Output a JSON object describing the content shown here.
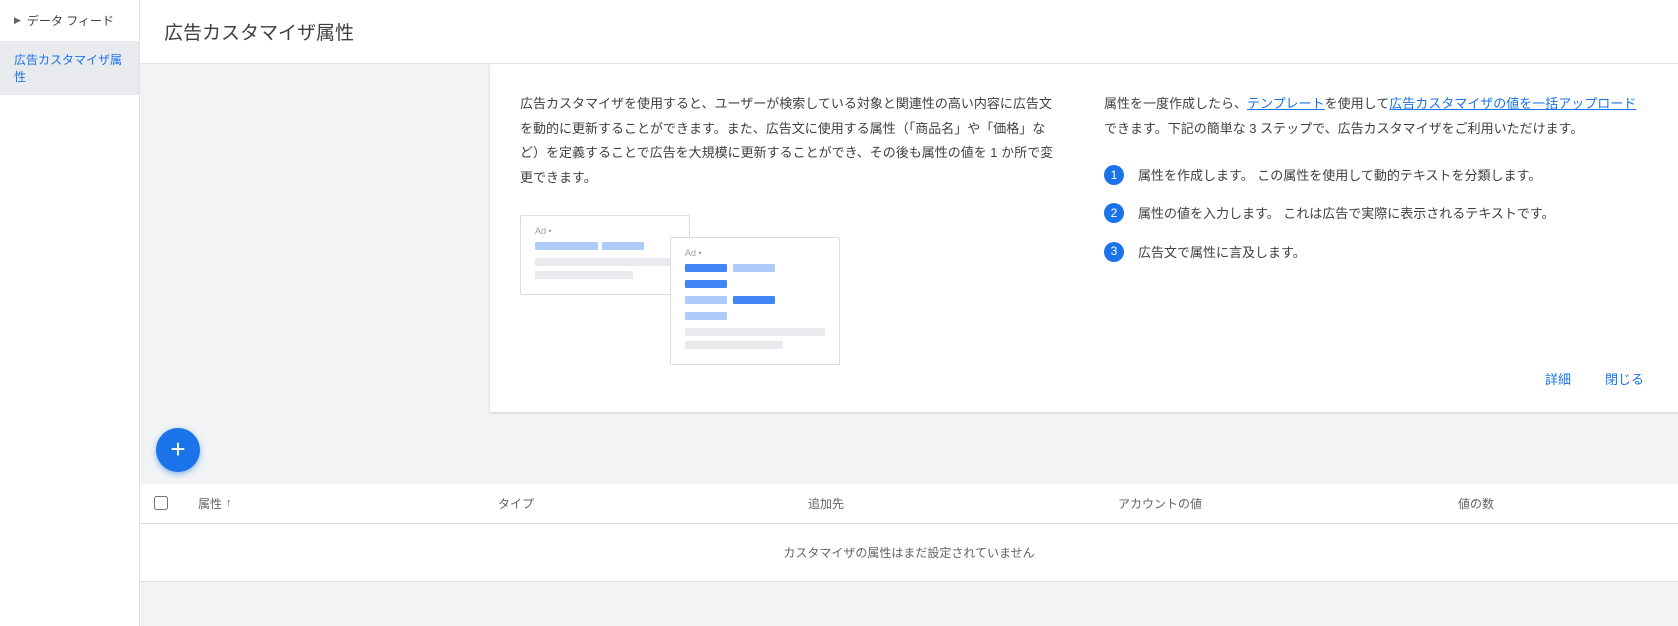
{
  "sidebar": {
    "data_feed_label": "データ フィード",
    "ad_customizer_label": "広告カスタマイザ属性"
  },
  "page": {
    "title": "広告カスタマイザ属性"
  },
  "card": {
    "left_description": "広告カスタマイザを使用すると、ユーザーが検索している対象と関連性の高い内容に広告文を動的に更新することができます。また、広告文に使用する属性（「商品名」や「価格」など）を定義することで広告を大規模に更新することができ、その後も属性の値を 1 か所で変更できます。",
    "ad_label": "Ad •",
    "right_intro_pre": "属性を一度作成したら、",
    "right_intro_link1": "テンプレート",
    "right_intro_mid1": "を使用して",
    "right_intro_link2": "広告カスタマイザの値を一括アップロード",
    "right_intro_post": "できます。下記の簡単な 3 ステップで、広告カスタマイザをご利用いただけます。",
    "steps": [
      "属性を作成します。 この属性を使用して動的テキストを分類します。",
      "属性の値を入力します。 これは広告で実際に表示されるテキストです。",
      "広告文で属性に言及します。"
    ],
    "details_label": "詳細",
    "close_label": "閉じる"
  },
  "fab": {
    "plus": "+"
  },
  "table": {
    "col_attribute": "属性",
    "sort_arrow": "↑",
    "col_type": "タイプ",
    "col_added_to": "追加先",
    "col_account_value": "アカウントの値",
    "col_value_count": "値の数",
    "empty_message": "カスタマイザの属性はまだ設定されていません"
  }
}
